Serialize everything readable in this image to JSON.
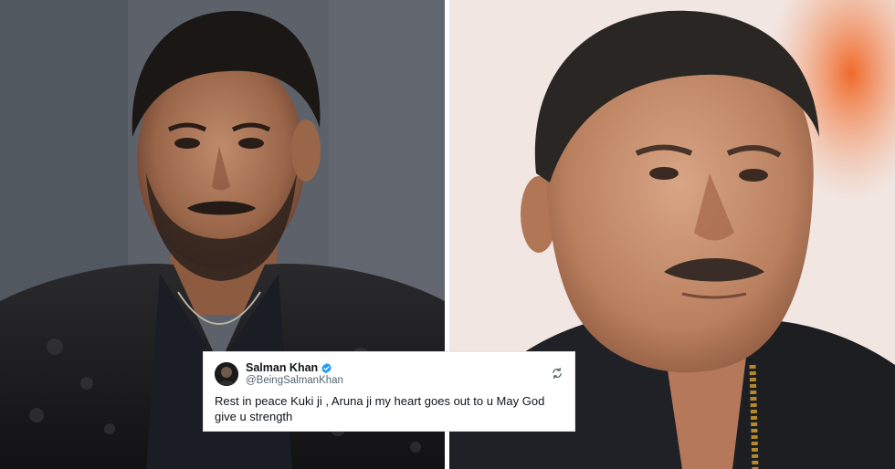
{
  "tweet": {
    "display_name": "Salman Khan",
    "handle": "@BeingSalmanKhan",
    "text": "Rest in peace Kuki ji , Aruna ji my heart goes out to u May God give u strength",
    "verified_color": "#1d9bf0",
    "verified_icon": "verified-badge-icon",
    "action_icon": "repost-icon"
  },
  "photos": {
    "left_subject": "man-with-beard-portrait",
    "right_subject": "older-man-with-mustache-portrait"
  }
}
